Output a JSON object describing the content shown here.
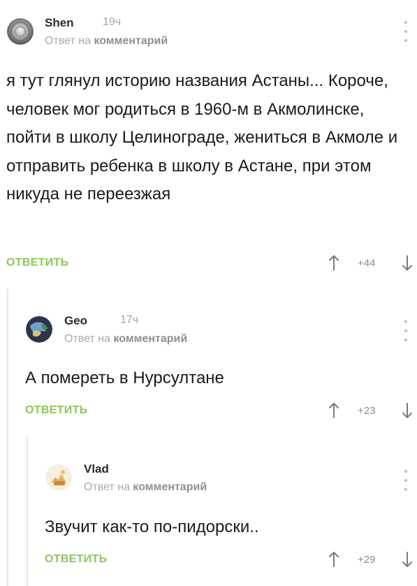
{
  "comments": [
    {
      "author": "Shen",
      "time": "19ч",
      "reply_prefix": "Ответ на",
      "reply_target": "комментарий",
      "text": "я тут глянул историю названия Астаны... Короче, человек мог родиться в 1960-м в Акмолинске, пойти в школу Целинограде, жениться в Акмоле и отправить ребенка в школу в Астане, при этом никуда не переезжая",
      "reply_label": "ОТВЕТИТЬ",
      "score": "+44"
    },
    {
      "author": "Geo",
      "time": "17ч",
      "reply_prefix": "Ответ на",
      "reply_target": "комментарий",
      "text": "А помереть в Нурсултане",
      "reply_label": "ОТВЕТИТЬ",
      "score": "+23"
    },
    {
      "author": "Vlad",
      "time": "",
      "reply_prefix": "Ответ на",
      "reply_target": "комментарий",
      "text": "Звучит как-то по-пидорски..",
      "reply_label": "ОТВЕТИТЬ",
      "score": "+29"
    }
  ],
  "icons": {
    "upvote": "arrow-up-icon",
    "downvote": "arrow-down-icon",
    "menu": "more-vertical-icon"
  },
  "colors": {
    "reply_green": "#8ac858",
    "muted": "#a9a9a9",
    "thread_line": "#e4e4e4"
  }
}
